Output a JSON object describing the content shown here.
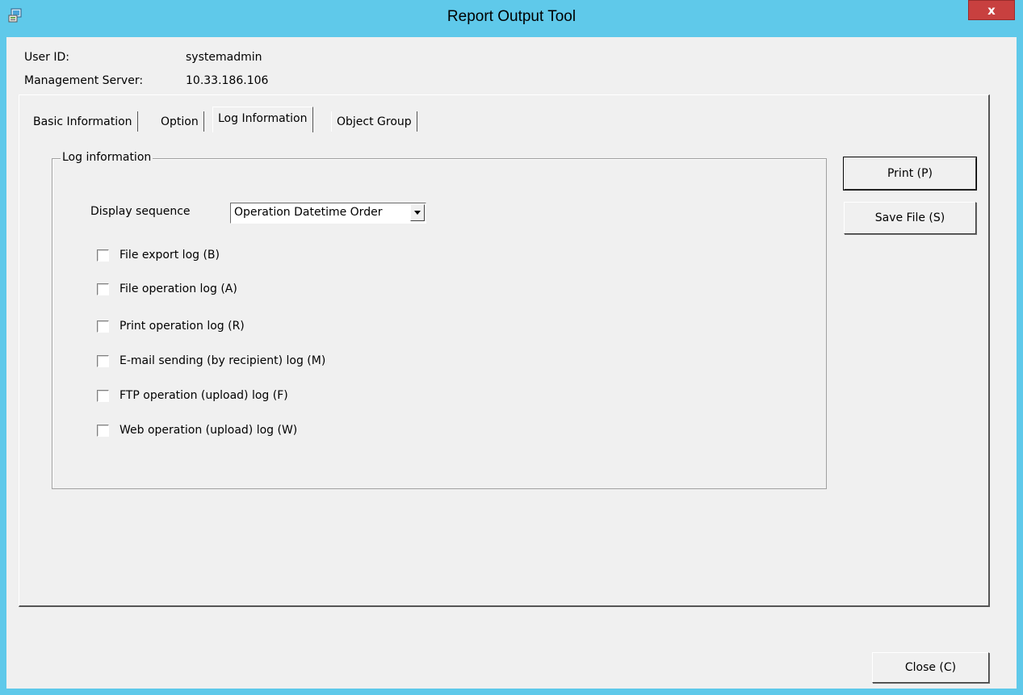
{
  "window": {
    "title": "Report Output Tool",
    "close_glyph": "x"
  },
  "info": {
    "user_id_label": "User ID:",
    "user_id_value": "systemadmin",
    "server_label": "Management Server:",
    "server_value": "10.33.186.106"
  },
  "tabs": [
    {
      "label": "Basic Information",
      "active": false
    },
    {
      "label": "Option",
      "active": false
    },
    {
      "label": "Log Information",
      "active": true
    },
    {
      "label": "Object Group",
      "active": false
    }
  ],
  "log_panel": {
    "group_title": "Log information",
    "display_sequence_label": "Display sequence",
    "display_sequence_value": "Operation Datetime Order",
    "checkboxes": [
      {
        "label": "File export log (B)",
        "checked": false
      },
      {
        "label": "File operation log (A)",
        "checked": false
      },
      {
        "label": "Print operation log (R)",
        "checked": false
      },
      {
        "label": "E-mail sending (by recipient) log (M)",
        "checked": false
      },
      {
        "label": "FTP operation (upload) log (F)",
        "checked": false
      },
      {
        "label": "Web operation (upload) log (W)",
        "checked": false
      }
    ]
  },
  "buttons": {
    "print": "Print (P)",
    "save_file": "Save File (S)",
    "close": "Close (C)"
  },
  "colors": {
    "titlebar": "#5fc9ea",
    "dialog_background": "#f0f0f0",
    "close_button": "#c8403f"
  }
}
